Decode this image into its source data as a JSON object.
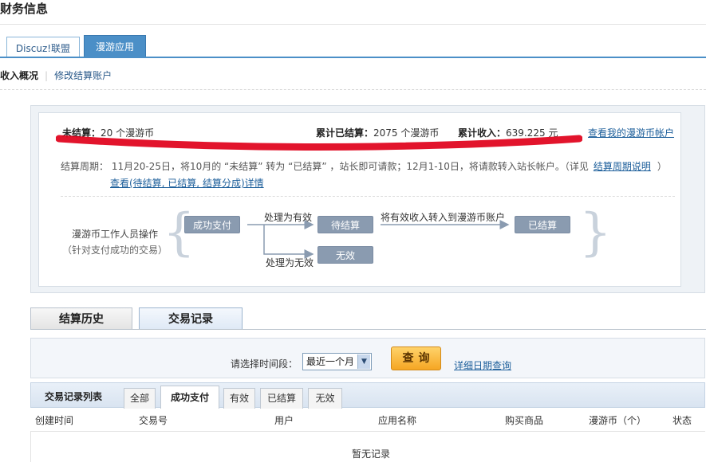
{
  "page": {
    "title": "财务信息"
  },
  "top_tabs": [
    {
      "label": "Discuz!联盟"
    },
    {
      "label": "漫游应用"
    }
  ],
  "subnav": {
    "active": "收入概况",
    "link": "修改结算账户"
  },
  "summary": {
    "unsettled_label": "未结算：",
    "unsettled_value": "20 个漫游币",
    "settled_label": "累计已结算：",
    "settled_value": "2075 个漫游币",
    "income_label": "累计收入：",
    "income_value": "639.225 元",
    "account_link": "查看我的漫游币帐户"
  },
  "cycle": {
    "text": "结算周期：  11月20-25日，将10月的 “未结算” 转为 “已结算” ，站长即可请款；12月1-10日，将请款转入站长帐户。（详见",
    "link": "结算周期说明",
    "close": "）",
    "detail_link": "查看(待结算, 已结算, 结算分成)详情"
  },
  "flow": {
    "actor": "漫游币工作人员操作",
    "actor_note": "（针对支付成功的交易）",
    "box_success": "成功支付",
    "to_valid": "处理为有效",
    "to_invalid": "处理为无效",
    "box_pending": "待结算",
    "box_invalid": "无效",
    "transfer": "将有效收入转入到漫游币账户",
    "box_settled": "已结算"
  },
  "mid_tabs": [
    {
      "label": "结算历史"
    },
    {
      "label": "交易记录"
    }
  ],
  "query": {
    "label": "请选择时间段：",
    "select_value": "最近一个月",
    "button": "查询",
    "date_link": "详细日期查询"
  },
  "list": {
    "title": "交易记录列表",
    "filters": [
      "全部",
      "成功支付",
      "有效",
      "已结算",
      "无效"
    ],
    "active_filter": "成功支付",
    "columns": [
      "创建时间",
      "交易号",
      "用户",
      "应用名称",
      "购买商品",
      "漫游币（个）",
      "状态"
    ],
    "empty": "暂无记录"
  },
  "colors": {
    "accent": "#4b8fc7",
    "highlight": "#e0001a",
    "button": "#f5a623"
  }
}
